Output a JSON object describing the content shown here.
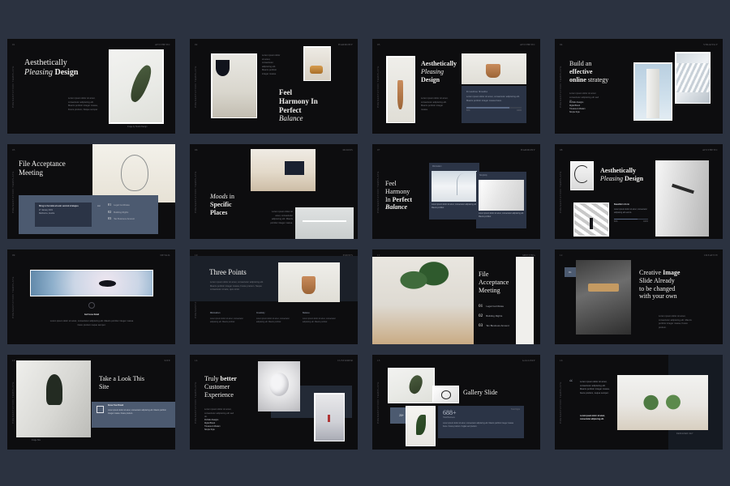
{
  "meta": {
    "background_color": "#2b3240",
    "slide_color": "#0d0d0f",
    "accent_blue": "#4c5a70",
    "rows": 4,
    "cols": 4
  },
  "slides": [
    {
      "index": "01",
      "corner_right": "AESTHETIC",
      "rail": "PRESENTATION TEMPLATE",
      "title_line1": "Aesthetically",
      "title_line2_italic": "Pleasing",
      "title_line2_rest": "Design",
      "body": "Lorem ipsum dolor sit amet, consectetur adipiscing elit. Mauris porttitor integer massa, Fusce pretium, Neque semper.",
      "caption": "Image by Studio Design"
    },
    {
      "index": "02",
      "corner_right": "HARMONY",
      "rail": "PRESENTATION TEMPLATE",
      "title_line1": "Feel",
      "title_line2": "Harmony In",
      "title_line3": "Perfect",
      "title_line4_italic": "Balance",
      "body": "Lorem ipsum dolor sit amet, consectetur adipiscing elit. Mauris porttitor integer massa."
    },
    {
      "index": "03",
      "corner_right": "AESTHETIC",
      "rail": "PRESENTATION TEMPLATE",
      "title_line1": "Aesthetically",
      "title_line2_italic": "Pleasing",
      "title_line3": "Design",
      "body": "Lorem ipsum dolor sit amet, consectetur adipiscing elit. Mauris porttitor integer massa.",
      "card_title": "Creative Studio",
      "card_body": "Lorem ipsum dolor sit amet, consectetur adipiscing elit. Mauris porttitor integer massa fusce.",
      "card_value_left": "80%",
      "card_value_right": "100%"
    },
    {
      "index": "04",
      "corner_right": "STRATEGY",
      "rail": "PRESENTATION TEMPLATE",
      "title_line1": "Build an",
      "title_line2_bold": "effective",
      "title_line3_bold": "online",
      "title_line3_rest": " strategy",
      "body": "Lorem ipsum dolor sit amet consectetur adipiscing elit sed do.",
      "list": [
        "Portfolio Designs",
        "Digital Brand",
        "Timeless & Modern",
        "Simple Style"
      ]
    },
    {
      "index": "05",
      "corner_right": "MEETING",
      "rail": "PRESENTATION TEMPLATE",
      "title_line1": "File Acceptance",
      "title_line2": "Meeting",
      "card_title": "Bring to the table win-win survival strategies",
      "card_meta": [
        "27 January 2021",
        "Melbourne, Austria"
      ],
      "list_label": "List",
      "items": [
        {
          "num": "01",
          "label": "Legal Certificate"
        },
        {
          "num": "02",
          "label": "Building Rights"
        },
        {
          "num": "03",
          "label": "Tax Business Amount"
        }
      ]
    },
    {
      "index": "06",
      "corner_right": "MOODS",
      "rail": "PRESENTATION TEMPLATE",
      "title_line1_italic": "Moods",
      "title_line1_rest": " in",
      "title_line2": "Specific",
      "title_line3": "Places",
      "body": "Lorem ipsum dolor sit amet, consectetur adipiscing elit. Mauris porttitor integer massa."
    },
    {
      "index": "07",
      "corner_right": "HARMONY",
      "rail": "PRESENTATION TEMPLATE",
      "title_line1": "Feel",
      "title_line2": "Harmony",
      "title_line3a": "In ",
      "title_line3b_bold": "Perfect",
      "title_line4_italic": "Balance",
      "card1_label": "Minimalism",
      "card1_body": "Lorem ipsum dolor sit amet, consectetur adipiscing elit. Mauris porttitor.",
      "card2_label": "Simplicity",
      "card2_body": "Lorem ipsum dolor sit amet, consectetur adipiscing elit. Mauris porttitor."
    },
    {
      "index": "08",
      "corner_right": "AESTHETIC",
      "rail": "PRESENTATION TEMPLATE",
      "title_line1": "Aesthetically",
      "title_line2_italic": "Pleasing",
      "title_line2_rest": "Design",
      "section_title": "Beautiful in Form",
      "section_body": "Lorem ipsum dolor sit amet, consectetur adipiscing elit sed do.",
      "stat_left": "80%",
      "stat_right": "100%"
    },
    {
      "index": "09",
      "corner_right": "DETAIL",
      "rail": "PRESENTATION TEMPLATE",
      "heading": "Get Focus Detail",
      "body": "Lorem ipsum dolor sit amet, consectetur adipiscing elit. Mauris porttitor integer massa fusce pretium neque semper."
    },
    {
      "index": "10",
      "corner_right": "POINTS",
      "rail": "PRESENTATION TEMPLATE",
      "title": "Three Points",
      "subtitle": "Lorem ipsum dolor sit amet, consectetur adipiscing elit. Mauris porttitor integer massa, Fusce pretium. Neque consectetur ornare, quis tortor.",
      "columns": [
        {
          "label": "Minimalism",
          "body": "Lorem ipsum dolor sit amet, consectetur adipiscing elit. Mauris porttitor."
        },
        {
          "label": "Creativity",
          "body": "Lorem ipsum dolor sit amet, consectetur adipiscing elit. Mauris porttitor."
        },
        {
          "label": "Balance",
          "body": "Lorem ipsum dolor sit amet, consectetur adipiscing elit. Mauris porttitor."
        }
      ]
    },
    {
      "index": "11",
      "corner_right": "MEETING",
      "rail": "PRESENTATION TEMPLATE",
      "title_line1": "File",
      "title_line2": "Acceptance",
      "title_line3": "Meeting",
      "items": [
        {
          "num": "01",
          "label": "Legal Certificate"
        },
        {
          "num": "02",
          "label": "Building Rights"
        },
        {
          "num": "03",
          "label": "Tax Business Amount"
        }
      ]
    },
    {
      "index": "12",
      "corner_right": "CREATIVE",
      "rail": "PRESENTATION TEMPLATE",
      "badge": "01",
      "title_line1a": "Creative ",
      "title_line1b_bold": "Image",
      "title_line2": "Slide Already",
      "title_line3": "to be changed",
      "title_line4": "with your own",
      "body": "Lorem ipsum dolor sit amet, consectetur adipiscing elit. Mauris porttitor integer massa, Fusce pretium."
    },
    {
      "index": "13",
      "corner_right": "SITE",
      "rail": "PRESENTATION TEMPLATE",
      "title_line1": "Take a Look This",
      "title_line2": "Site",
      "card_title": "Know Your Brand",
      "card_body": "Lorem ipsum dolor sit amet, consectetur adipiscing elit. Mauris porttitor integer massa. Fusce pretium.",
      "caption": "Image Site"
    },
    {
      "index": "14",
      "corner_right": "CUSTOMER",
      "rail": "PRESENTATION TEMPLATE",
      "title_line1a": "Truly ",
      "title_line1b_bold": "better",
      "title_line2": "Customer",
      "title_line3": "Experience",
      "body": "Lorem ipsum dolor sit amet, consectetur adipiscing elit sed do.",
      "list": [
        "Portfolio Designs",
        "Digital Brand",
        "Timeless & Modern",
        "Simple Style"
      ]
    },
    {
      "index": "15",
      "corner_right": "GALLERY",
      "rail": "PRESENTATION TEMPLATE",
      "title": "Gallery Slide",
      "badge": "20+",
      "stat_value": "688+",
      "stat_label": "Total Business",
      "stat_body": "Lorem ipsum dolor sit amet, consectetur adipiscing elit. Mauris porttitor integer massa fusce. Fusce pretium. Fugiat sed pretium.",
      "stat_corner": "Total Digits"
    },
    {
      "index": "16",
      "corner_right": "QUOTE",
      "rail": "PRESENTATION TEMPLATE",
      "quote_mark": "“",
      "quote": "Lorem ipsum dolor sit amet, consectetur adipiscing elit. Mauris porttitor integer massa, fusce pretium, neque semper.",
      "author": "Lorem ipsum dolor sit amet, consectetur adipiscing elit.",
      "caption": "DESIGNER KEY"
    }
  ]
}
